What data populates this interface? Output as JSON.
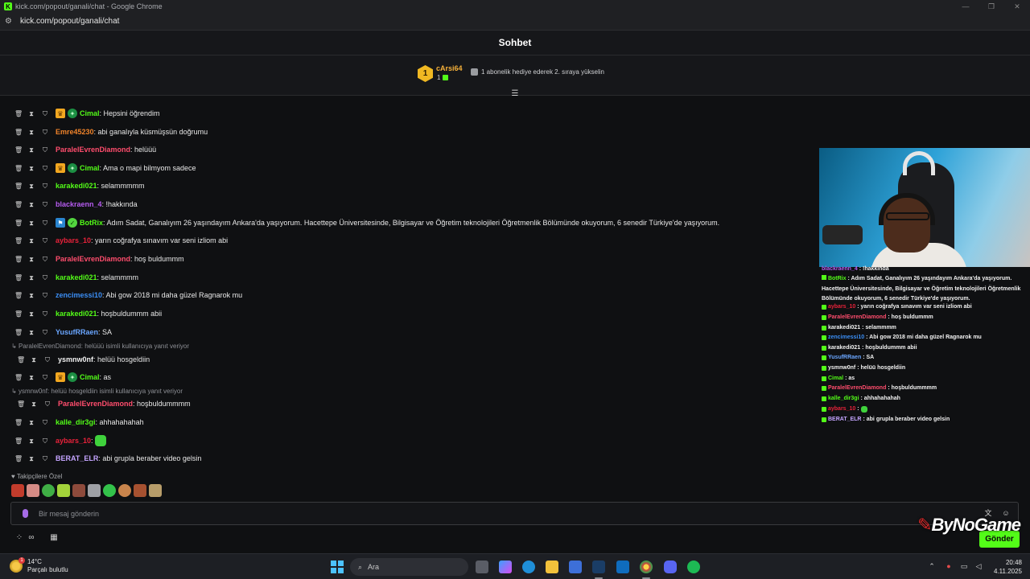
{
  "browser": {
    "title": "kick.com/popout/ganali/chat - Google Chrome",
    "url": "kick.com/popout/ganali/chat",
    "favicon_letter": "K"
  },
  "chat": {
    "header_title": "Sohbet",
    "pinned": {
      "rank": "1",
      "username": "cArsi64",
      "gift_count": "1",
      "message": "1 abonelik hediye ederek 2. sıraya yükselin"
    },
    "messages": [
      {
        "user": "Cimal",
        "text": ": Hepsini öğrendim",
        "color": "#53fc18"
      },
      {
        "user": "Emre45230",
        "text": ": abi ganalıyla küsmüşsün doğrumu",
        "color": "#f0832a"
      },
      {
        "user": "ParalelEvrenDiamond",
        "text": ": helüüü",
        "color": "#ff4d6d"
      },
      {
        "user": "Cimal",
        "text": ": Ama o mapi bilmyom sadece",
        "color": "#53fc18"
      },
      {
        "user": "karakedi021",
        "text": ": selammmmm",
        "color": "#53fc18"
      },
      {
        "user": "blackraenn_4",
        "text": ": !hakkında",
        "color": "#b65cf0"
      },
      {
        "user": "BotRix",
        "text": ": Adım Sadat, Ganalıyım 26 yaşındayım Ankara'da yaşıyorum. Hacettepe Üniversitesinde, Bilgisayar ve Öğretim teknolojileri Öğretmenlik Bölümünde okuyorum, 6 senedir Türkiye'de yaşıyorum.",
        "color": "#53fc18"
      },
      {
        "user": "aybars_10",
        "text": ": yarın coğrafya sınavım var seni izliom abi",
        "color": "#e8223a"
      },
      {
        "user": "ParalelEvrenDiamond",
        "text": ": hoş buldummm",
        "color": "#ff4d6d"
      },
      {
        "user": "karakedi021",
        "text": ": selammmm",
        "color": "#53fc18"
      },
      {
        "user": "zencimessi10",
        "text": ": Abi gow 2018 mi daha güzel Ragnarok mu",
        "color": "#3b8ef5"
      },
      {
        "user": "karakedi021",
        "text": ": hoşbuldummm abii",
        "color": "#53fc18"
      },
      {
        "user": "YusufRRaen",
        "text": ": SA",
        "color": "#6aa6ff"
      },
      {
        "user": "ysmnw0nf",
        "text": ": helüü hosgeldiin",
        "color": "#f2f2f2"
      },
      {
        "user": "Cimal",
        "text": ": as",
        "color": "#53fc18"
      },
      {
        "user": "ParalelEvrenDiamond",
        "text": ": hoşbuldummmm",
        "color": "#ff4d6d"
      },
      {
        "user": "kalle_dir3gi",
        "text": ": ahhahahahah",
        "color": "#53fc18"
      },
      {
        "user": "aybars_10",
        "text": ":",
        "color": "#e8223a"
      },
      {
        "user": "BERAT_ELR",
        "text": ": abi grupla beraber video gelsin",
        "color": "#c4a4ff"
      }
    ],
    "replies": [
      "ParalelEvrenDiamond: helüüü isimli kullanıcıya yanıt veriyor",
      "ysmnw0nf: helüü hosgeldiin isimli kullanıcıya yanıt veriyor"
    ],
    "followers_label": "Takipçilere Özel",
    "input_placeholder": "Bir mesaj gönderin",
    "send_label": "Gönder"
  },
  "overlay": {
    "lines": [
      {
        "user": "blackraenn_4",
        "text": " : !hakkında",
        "color": "#b65cf0"
      },
      {
        "user": "aybars_10",
        "text": " : yarın coğrafya sınavım var seni izliom abi",
        "color": "#e8223a"
      },
      {
        "user": "ParalelEvrenDiamond",
        "text": " : hoş buldummm",
        "color": "#ff4d6d"
      },
      {
        "user": "karakedi021",
        "text": " : selammmm",
        "color": "#f2f2f2"
      },
      {
        "user": "zencimessi10",
        "text": " : Abi gow 2018 mi daha güzel Ragnarok mu",
        "color": "#3b8ef5"
      },
      {
        "user": "karakedi021",
        "text": " : hoşbuldummm abii",
        "color": "#f2f2f2"
      },
      {
        "user": "YusufRRaen",
        "text": " : SA",
        "color": "#6aa6ff"
      },
      {
        "user": "ysmnw0nf",
        "text": " : helüü hosgeldiin",
        "color": "#f2f2f2"
      },
      {
        "user": "Cimal",
        "text": " : as",
        "color": "#53fc18"
      },
      {
        "user": "ParalelEvrenDiamond",
        "text": " : hoşbuldummmm",
        "color": "#ff4d6d"
      },
      {
        "user": "kalle_dir3gi",
        "text": " : ahhahahahah",
        "color": "#53fc18"
      },
      {
        "user": "aybars_10",
        "text": " :",
        "color": "#e8223a"
      },
      {
        "user": "BERAT_ELR",
        "text": " : abi grupla beraber video gelsin",
        "color": "#c4a4ff"
      }
    ],
    "botrix_user": "BotRix",
    "botrix_text": " : Adım Sadat, Ganalıyım 26 yaşındayım Ankara'da yaşıyorum. Hacettepe Üniversitesinde, Bilgisayar ve Öğretim teknolojileri Öğretmenlik Bölümünde okuyorum, 6 senedir Türkiye'de yaşıyorum.",
    "watermark_by": "By",
    "watermark_no": "No",
    "watermark_game": "Game"
  },
  "taskbar": {
    "weather_temp": "14°C",
    "weather_desc": "Parçalı bulutlu",
    "weather_badge": "1",
    "search_label": "Ara",
    "time": "20:48",
    "date": "4.11.2025"
  }
}
